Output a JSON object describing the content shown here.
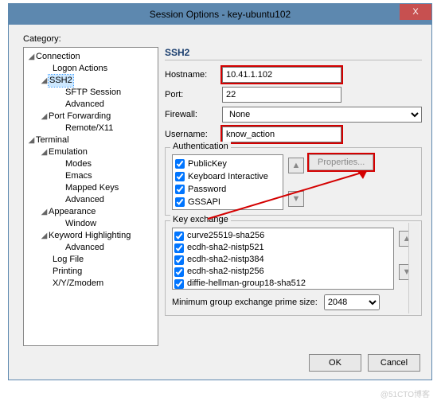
{
  "window": {
    "title": "Session Options - key-ubuntu102",
    "close": "X"
  },
  "categoryLabel": "Category:",
  "tree": {
    "connection": "Connection",
    "logon": "Logon Actions",
    "ssh2": "SSH2",
    "sftp": "SFTP Session",
    "advanced1": "Advanced",
    "portfw": "Port Forwarding",
    "remotex": "Remote/X11",
    "terminal": "Terminal",
    "emulation": "Emulation",
    "modes": "Modes",
    "emacs": "Emacs",
    "mapped": "Mapped Keys",
    "advanced2": "Advanced",
    "appearance": "Appearance",
    "windowItem": "Window",
    "keyword": "Keyword Highlighting",
    "advanced3": "Advanced",
    "logfile": "Log File",
    "printing": "Printing",
    "xyz": "X/Y/Zmodem"
  },
  "panel": {
    "section": "SSH2",
    "hostLabel": "Hostname:",
    "host": "10.41.1.102",
    "portLabel": "Port:",
    "port": "22",
    "fwLabel": "Firewall:",
    "fw": "None",
    "userLabel": "Username:",
    "user": "know_action",
    "auth": {
      "title": "Authentication",
      "pk": "PublicKey",
      "ki": "Keyboard Interactive",
      "pw": "Password",
      "gss": "GSSAPI",
      "props": "Properties..."
    },
    "kex": {
      "title": "Key exchange",
      "k0": "curve25519-sha256",
      "k1": "ecdh-sha2-nistp521",
      "k2": "ecdh-sha2-nistp384",
      "k3": "ecdh-sha2-nistp256",
      "k4": "diffie-hellman-group18-sha512"
    },
    "minLabel": "Minimum group exchange prime size:",
    "minVal": "2048"
  },
  "footer": {
    "ok": "OK",
    "cancel": "Cancel"
  },
  "watermark": "@51CTO博客"
}
